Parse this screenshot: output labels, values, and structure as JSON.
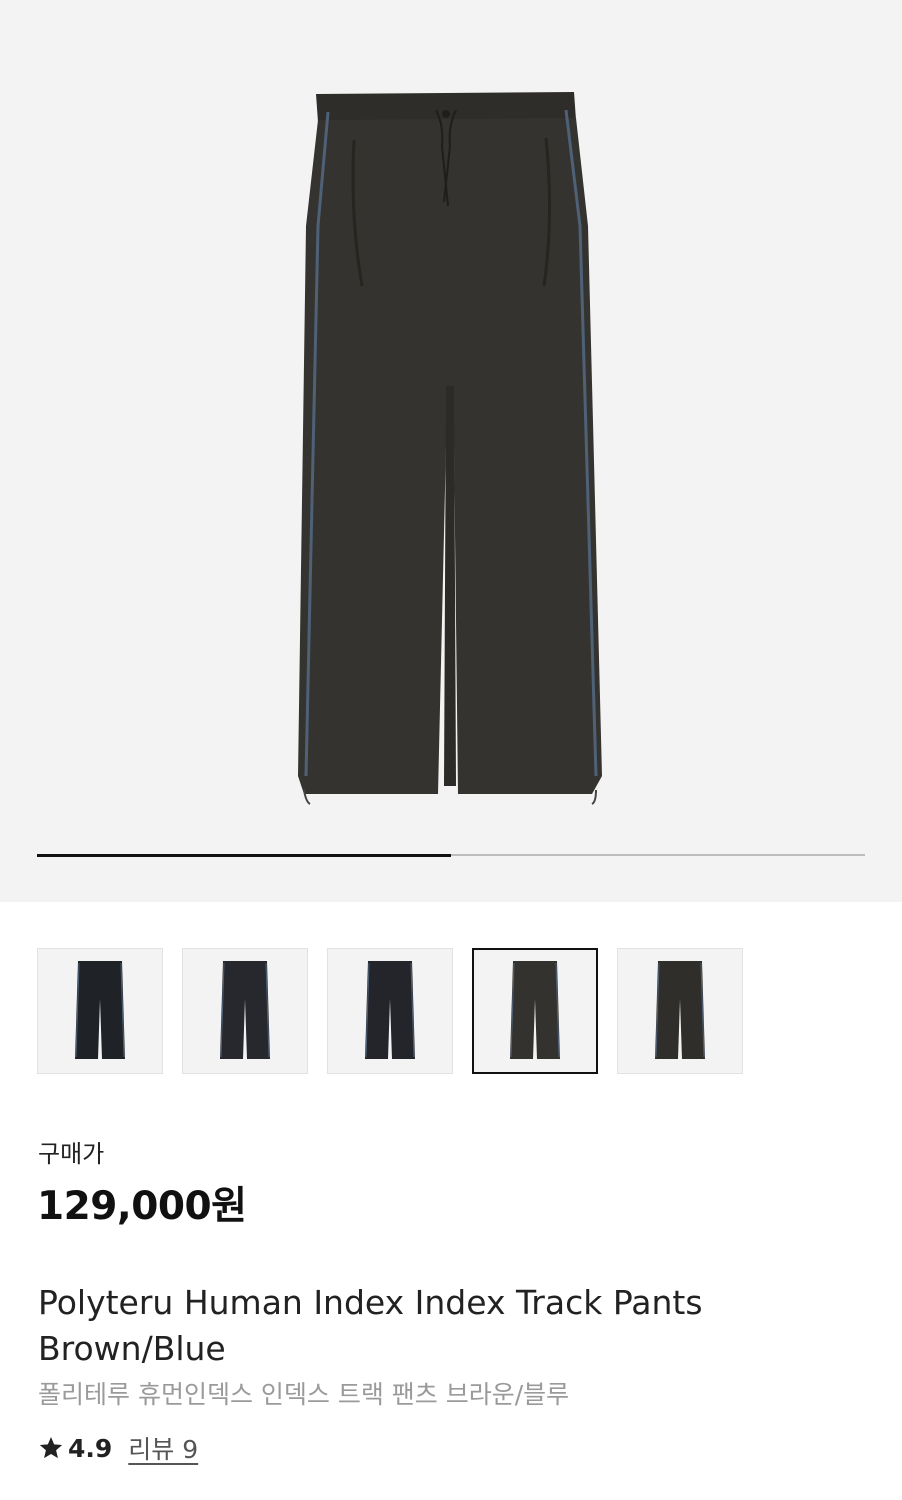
{
  "gallery": {
    "image_count": 2,
    "current_index": 1,
    "progress": 0.5
  },
  "thumbnails": [
    {
      "color": "#1f2227",
      "selected": false
    },
    {
      "color": "#26282e",
      "selected": false
    },
    {
      "color": "#23252b",
      "selected": false
    },
    {
      "color": "#34322e",
      "selected": true
    },
    {
      "color": "#2f2e2b",
      "selected": false
    }
  ],
  "price": {
    "label": "구매가",
    "value": "129,000원"
  },
  "product": {
    "name_en": "Polyteru Human Index Index Track Pants Brown/Blue",
    "name_ko": "폴리테루 휴먼인덱스 인덱스 트랙 팬츠 브라운/블루"
  },
  "rating": {
    "icon": "star-icon",
    "value": "4.9",
    "review_link": "리뷰 9"
  },
  "colors": {
    "pants": "#35332f",
    "piping": "#4e6177",
    "background": "#f3f3f3"
  }
}
